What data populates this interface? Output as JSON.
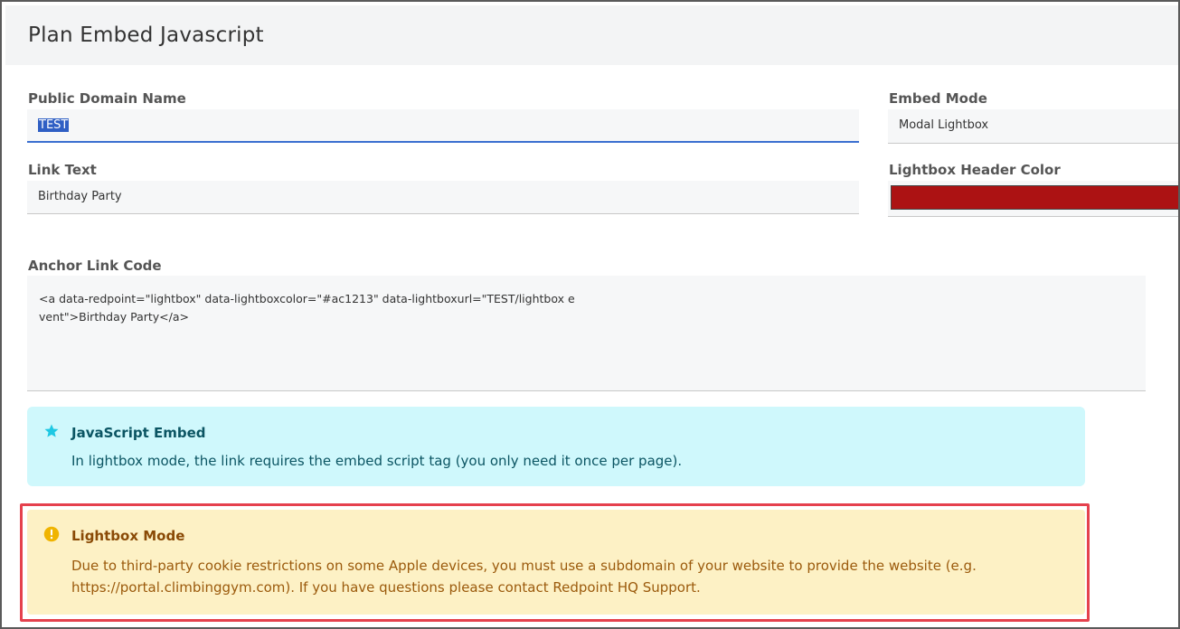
{
  "page": {
    "title": "Plan Embed Javascript"
  },
  "form": {
    "domain_label": "Public Domain Name",
    "domain_value": "TEST",
    "embed_mode_label": "Embed Mode",
    "embed_mode_value": "Modal Lightbox",
    "link_text_label": "Link Text",
    "link_text_value": "Birthday Party",
    "header_color_label": "Lightbox Header Color",
    "header_color_value": "#ac1213",
    "anchor_label": "Anchor Link Code",
    "anchor_code": "<a data-redpoint=\"lightbox\" data-lightboxcolor=\"#ac1213\" data-lightboxurl=\"TEST/lightbox event\">Birthday Party</a>"
  },
  "alerts": {
    "info": {
      "icon": "star-icon",
      "title": "JavaScript Embed",
      "text": "In lightbox mode, the link requires the embed script tag (you only need it once per page)."
    },
    "warning": {
      "icon": "exclamation-circle-icon",
      "title": "Lightbox Mode",
      "text": "Due to third-party cookie restrictions on some Apple devices, you must use a subdomain of your website to provide the website (e.g. https://portal.climbinggym.com). If you have questions please contact Redpoint HQ Support."
    }
  },
  "colors": {
    "info_bg": "#cff8fc",
    "warning_bg": "#fdf1c5",
    "highlight_outline": "#e5414d",
    "focus": "#3b6fd0"
  }
}
